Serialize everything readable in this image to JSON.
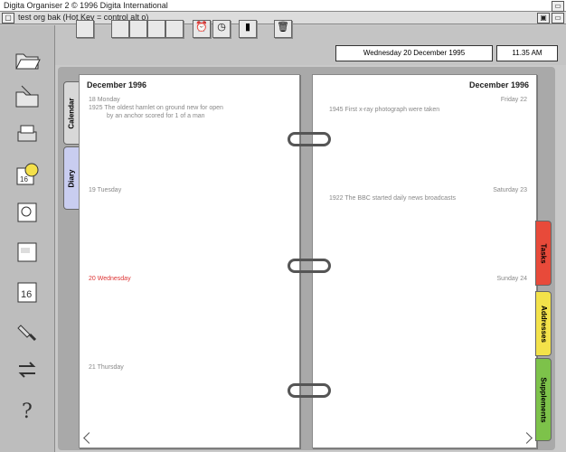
{
  "window": {
    "title": "Digita Organiser 2  © 1996 Digita International",
    "subtitle": "test org bak  (Hot Key = control alt o)"
  },
  "toolbar": {
    "date": "Wednesday 20 December 1995",
    "time": "11.35 AM"
  },
  "left_page": {
    "month": "December 1996",
    "days": [
      {
        "label": "18  Monday",
        "event": "1925  The oldest hamlet on ground new for open"
      },
      {
        "event": "by an anchor scored for 1 of a man"
      },
      {
        "label": "19  Tuesday"
      },
      {
        "label": "20  Wednesday"
      },
      {
        "label": "21  Thursday"
      }
    ]
  },
  "right_page": {
    "month": "December 1996",
    "days": [
      {
        "label": "Friday  22",
        "event": "1945  First x-ray photograph were taken"
      },
      {
        "label": "Saturday  23",
        "event": "1922  The BBC started daily news broadcasts"
      },
      {
        "label": "Sunday  24"
      }
    ]
  },
  "tabs": {
    "calendar": "Calendar",
    "diary": "Diary",
    "tasks": "Tasks",
    "addresses": "Addresses",
    "supplements": "Supplements"
  },
  "colors": {
    "accent_red": "#d33",
    "tab_tasks": "#e84a3a",
    "tab_addresses": "#f3e24a",
    "tab_supplements": "#7dc24a",
    "tab_diary": "#c9cdf0",
    "tab_calendar": "#d8d8d8"
  }
}
